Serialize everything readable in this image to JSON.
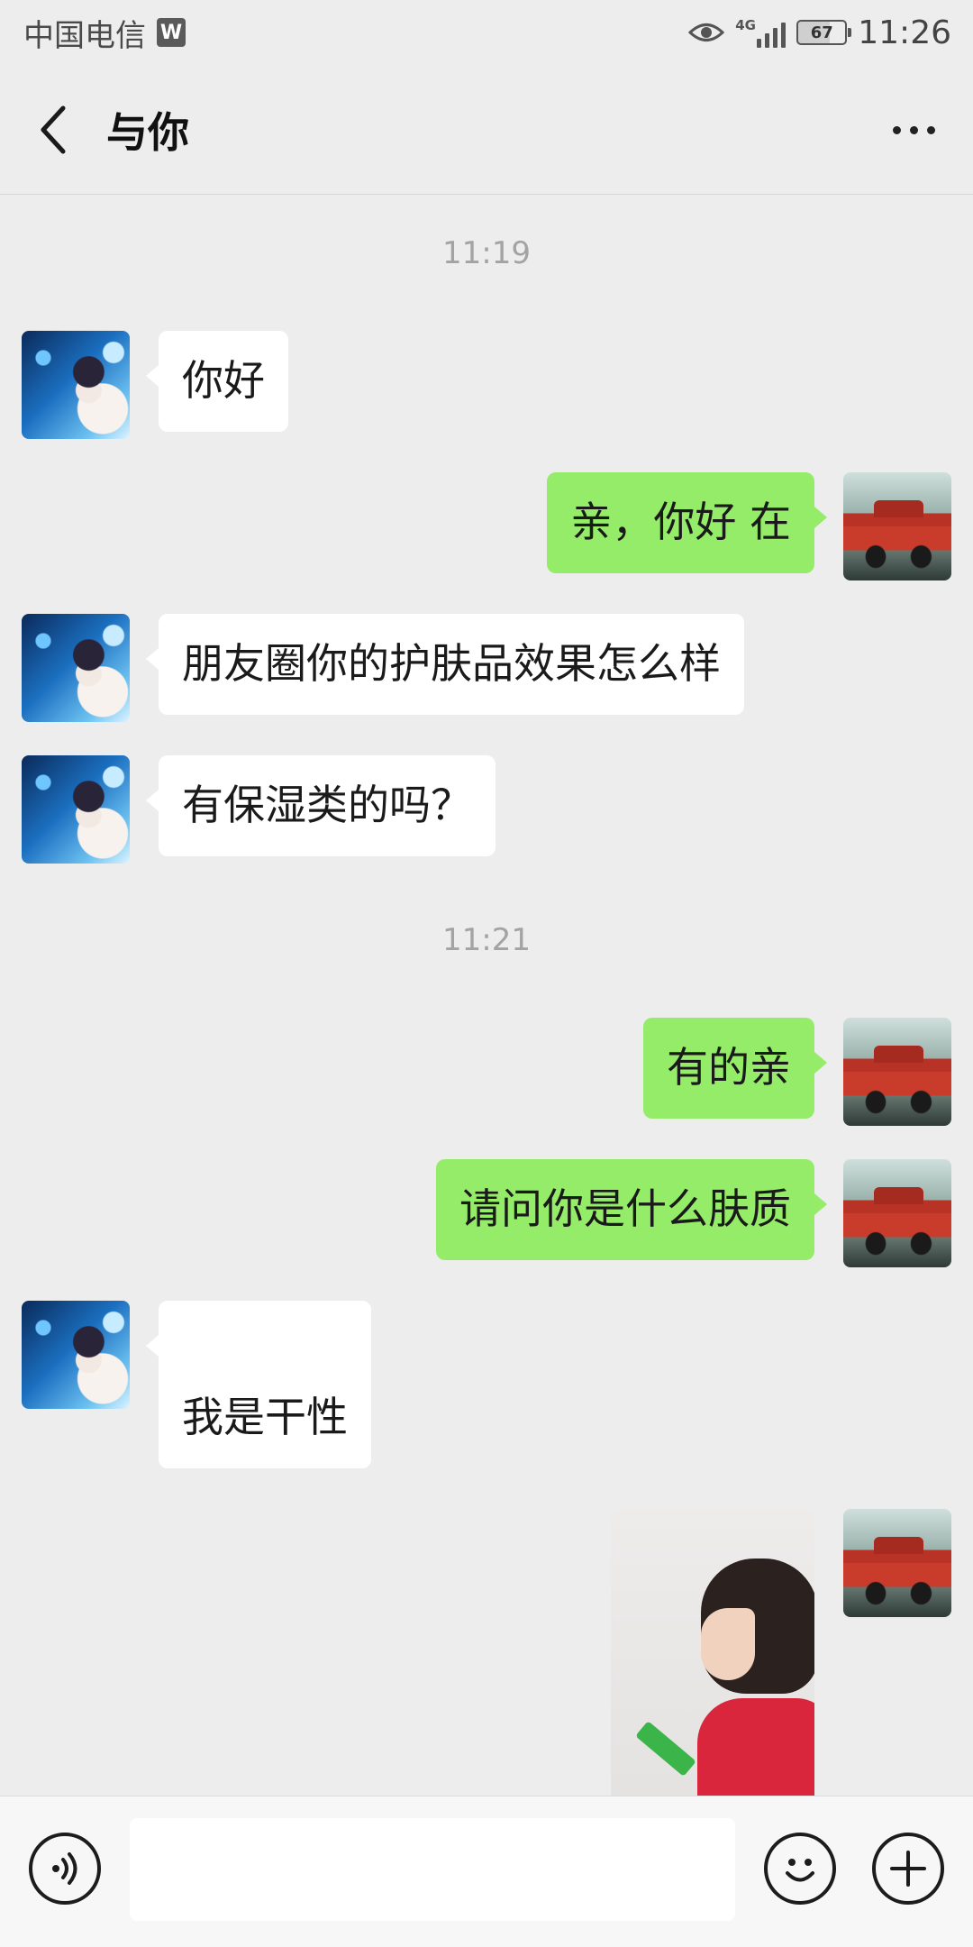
{
  "status_bar": {
    "carrier": "中国电信",
    "app_badge": "W",
    "network_type": "4G",
    "battery_level": "67",
    "time": "11:26"
  },
  "title_bar": {
    "title": "与你",
    "back_icon": "chevron-left-icon",
    "more_icon": "more-dots-icon"
  },
  "chat": {
    "timestamps": [
      "11:19",
      "11:21"
    ],
    "messages": [
      {
        "side": "in",
        "text": "你好",
        "avatar": "anime-avatar"
      },
      {
        "side": "out",
        "text": "亲，你好 在",
        "avatar": "car-avatar"
      },
      {
        "side": "in",
        "text": "朋友圈你的护肤品效果怎么样",
        "avatar": "anime-avatar"
      },
      {
        "side": "in",
        "text": "有保湿类的吗？",
        "avatar": "anime-avatar"
      },
      {
        "side": "out",
        "text": "有的亲",
        "avatar": "car-avatar"
      },
      {
        "side": "out",
        "text": "请问你是什么肤质",
        "avatar": "car-avatar"
      },
      {
        "side": "in",
        "text": "我是干性",
        "avatar": "anime-avatar"
      },
      {
        "side": "out",
        "type": "image",
        "avatar": "car-avatar"
      }
    ]
  },
  "input_bar": {
    "voice_icon": "voice-icon",
    "emoji_icon": "emoji-icon",
    "plus_icon": "plus-icon",
    "input_value": ""
  },
  "colors": {
    "background": "#ededed",
    "outgoing_bubble": "#95ec69",
    "incoming_bubble": "#ffffff",
    "timestamp": "#a3a3a3"
  }
}
